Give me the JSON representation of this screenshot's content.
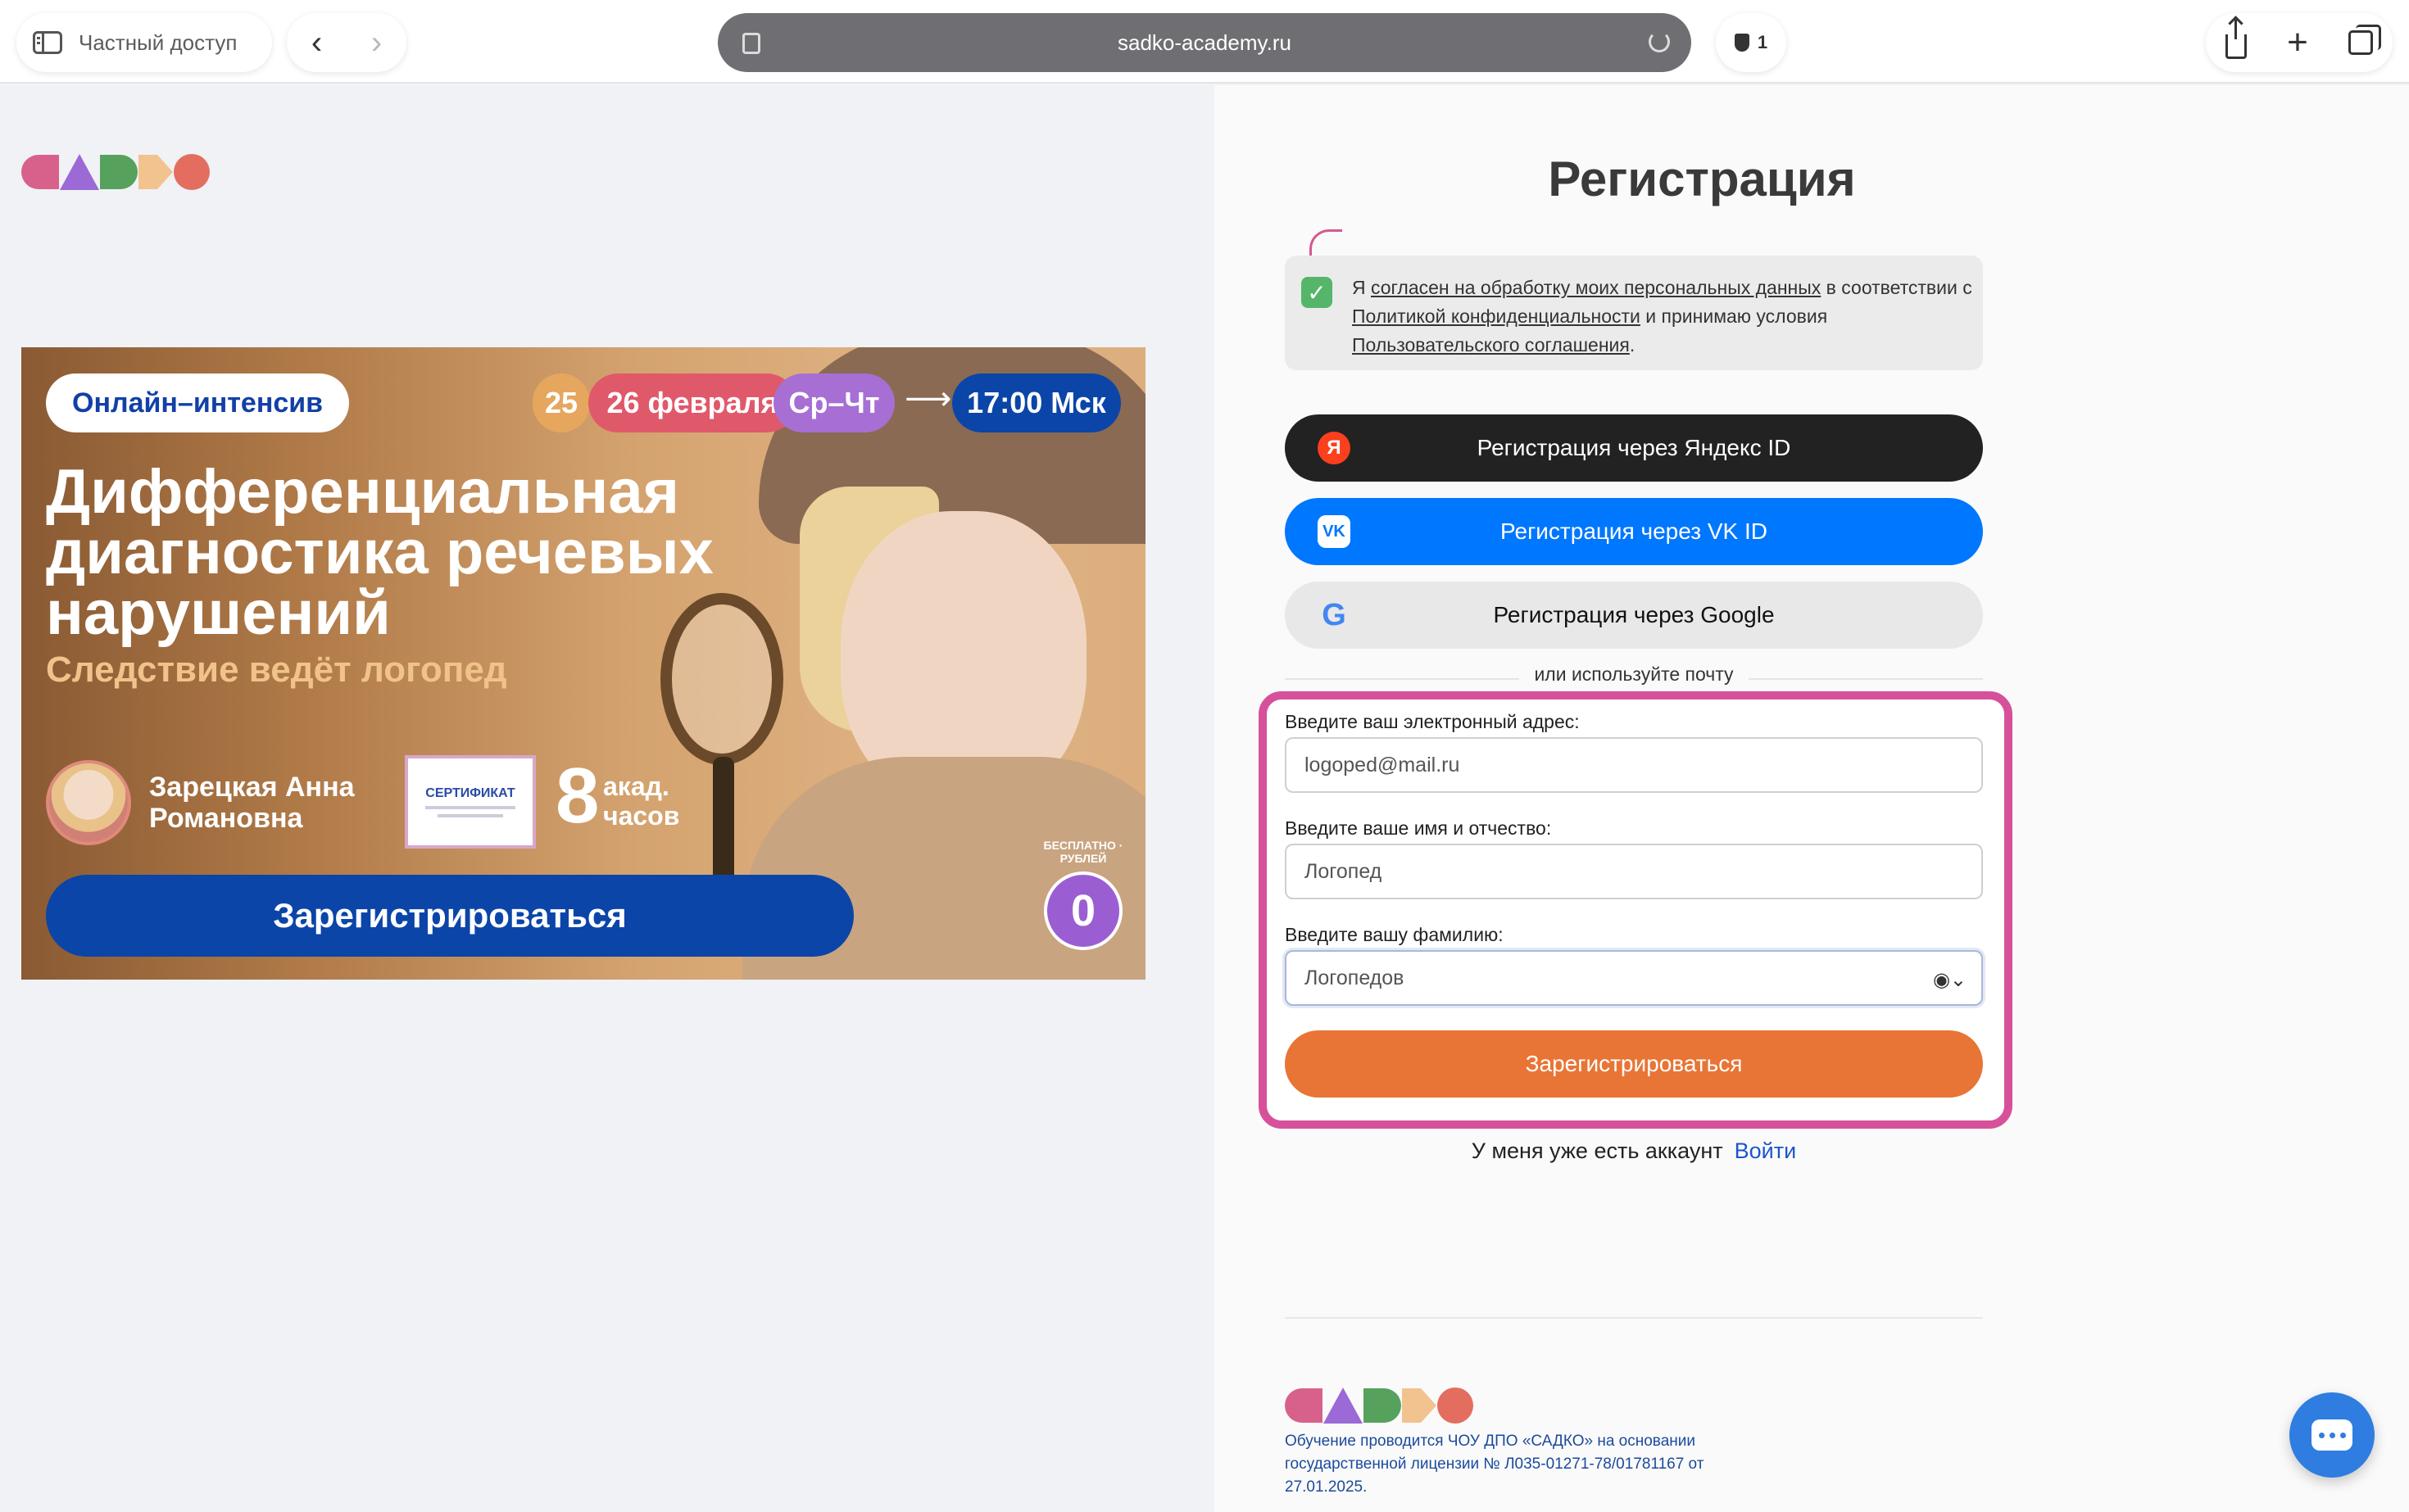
{
  "browser": {
    "private_label": "Частный доступ",
    "url": "sadko-academy.ru",
    "tracker_count": "1"
  },
  "banner": {
    "tag": "Онлайн–интенсив",
    "date_day1": "25",
    "date_day2": "26 февраля",
    "days": "Ср–Чт",
    "arrow": "⟶",
    "time": "17:00 Мск",
    "title": "Дифференциальная диагностика речевых нарушений",
    "subtitle": "Следствие ведёт логопед",
    "speaker": "Зарецкая Анна Романовна",
    "certificate": "СЕРТИФИКАТ",
    "hours_num": "8",
    "hours_text": "акад. часов",
    "cta": "Зарегистрироваться",
    "free_num": "0",
    "free_text": "БЕСПЛАТНО · РУБЛЕЙ"
  },
  "form": {
    "title": "Регистрация",
    "consent": {
      "p1": "Я ",
      "link1": "согласен на обработку моих персональных данных",
      "p2": " в соответствии с ",
      "link2": "Политикой конфиденциальности",
      "p3": " и принимаю условия ",
      "link3": "Пользовательского соглашения",
      "p4": "."
    },
    "yandex_label": "Регистрация через Яндекс ID",
    "vk_label": "Регистрация через VK ID",
    "google_label": "Регистрация через Google",
    "divider": "или используйте почту",
    "email_label": "Введите ваш электронный адрес:",
    "email_value": "logoped@mail.ru",
    "name_label": "Введите ваше имя и отчество:",
    "name_value": "Логопед",
    "surname_label": "Введите вашу фамилию:",
    "surname_value": "Логопедов",
    "submit": "Зарегистрироваться",
    "have_account": "У меня уже есть аккаунт",
    "login": "Войти"
  },
  "footer": {
    "license": "Обучение проводится ЧОУ ДПО «САДКО» на основании государственной лицензии № Л035-01271-78/01781167 от 27.01.2025."
  },
  "colors": {
    "brand_blue": "#0b45a8",
    "vk_blue": "#0077ff",
    "submit_orange": "#e87535",
    "form_highlight": "#d7519a"
  },
  "icons": [
    "sidebar-icon",
    "back-icon",
    "forward-icon",
    "reader-icon",
    "reload-icon",
    "shield-icon",
    "share-icon",
    "plus-icon",
    "tabs-icon",
    "check-icon",
    "yandex-icon",
    "vk-icon",
    "google-icon",
    "autofill-icon",
    "chat-icon"
  ]
}
